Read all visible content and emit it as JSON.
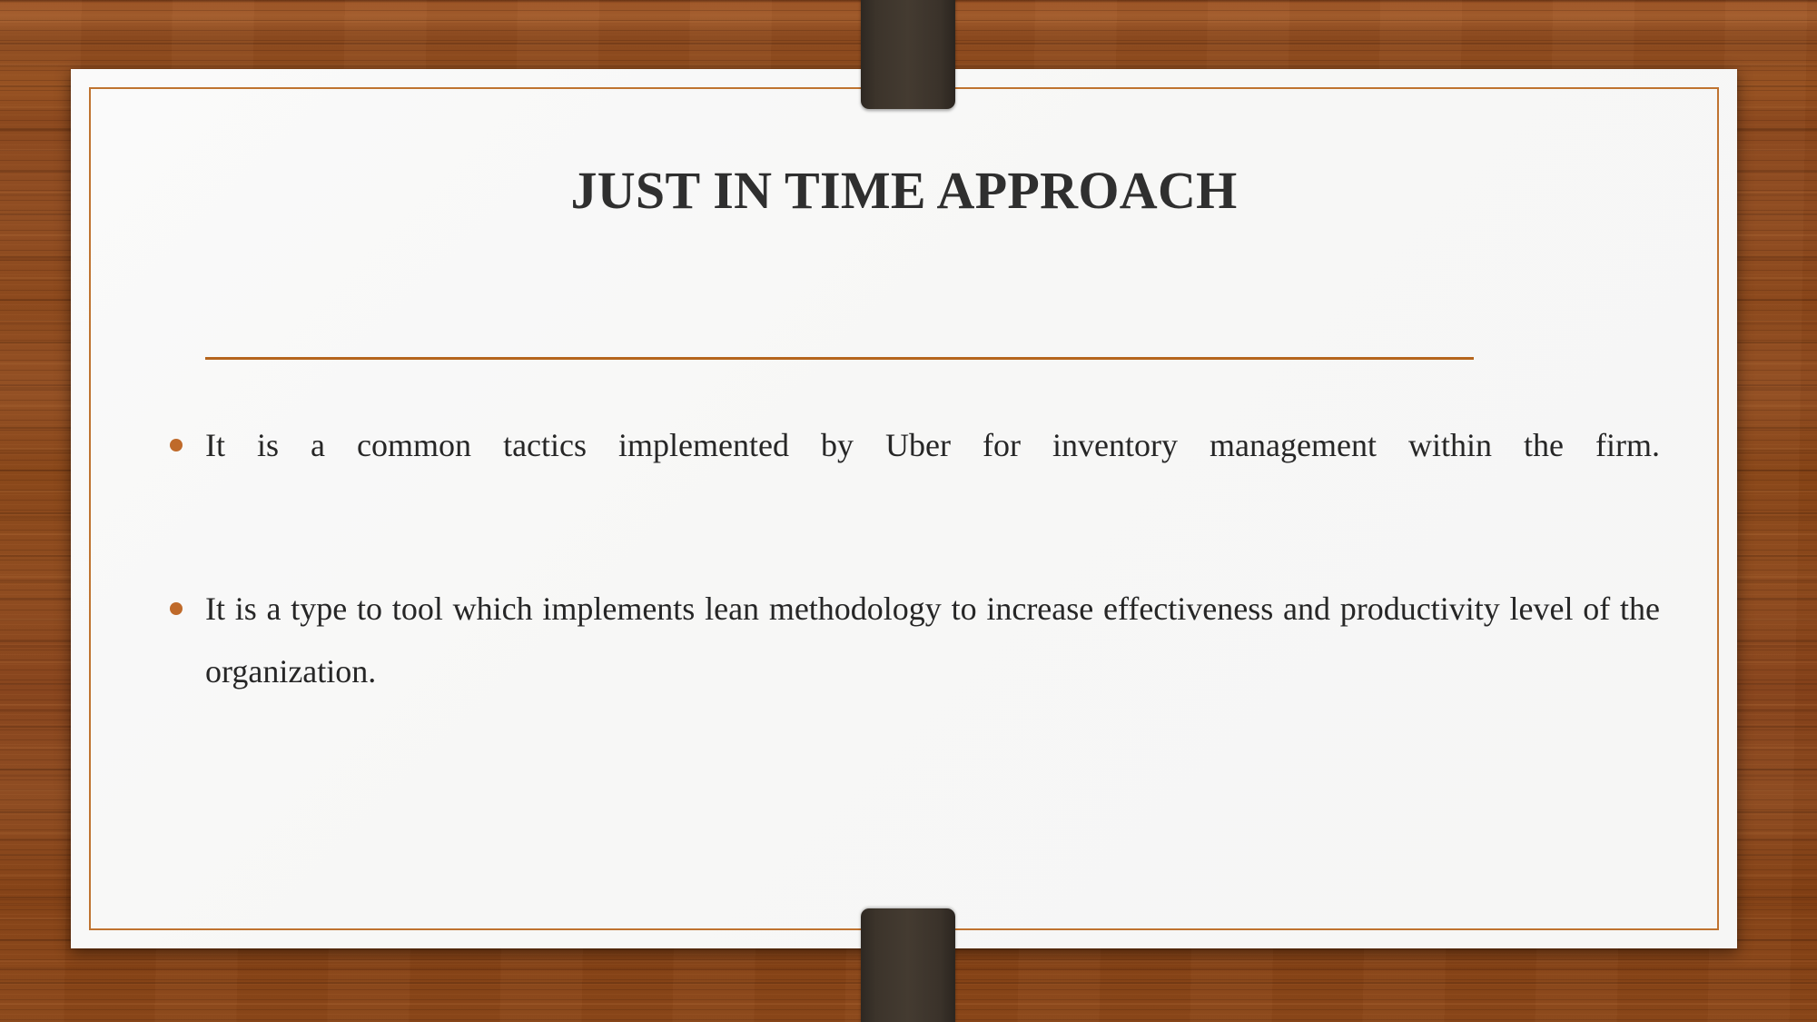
{
  "slide": {
    "title": "JUST IN TIME APPROACH",
    "bullets": [
      {
        "text": "It is a common tactics implemented by Uber for  inventory management within the firm."
      },
      {
        "text": "It is a type to tool which implements lean methodology to increase effectiveness and productivity level of the organization."
      }
    ]
  },
  "colors": {
    "accent_orange": "#b5651d",
    "bullet_dot": "#bf6a2a",
    "card_border": "#bf7330",
    "card_background": "#f8f8f7",
    "title_text": "#2f2f2f",
    "body_text": "#262626",
    "clip_dark": "#3a322a",
    "wood_background": "#8e4a1d"
  }
}
